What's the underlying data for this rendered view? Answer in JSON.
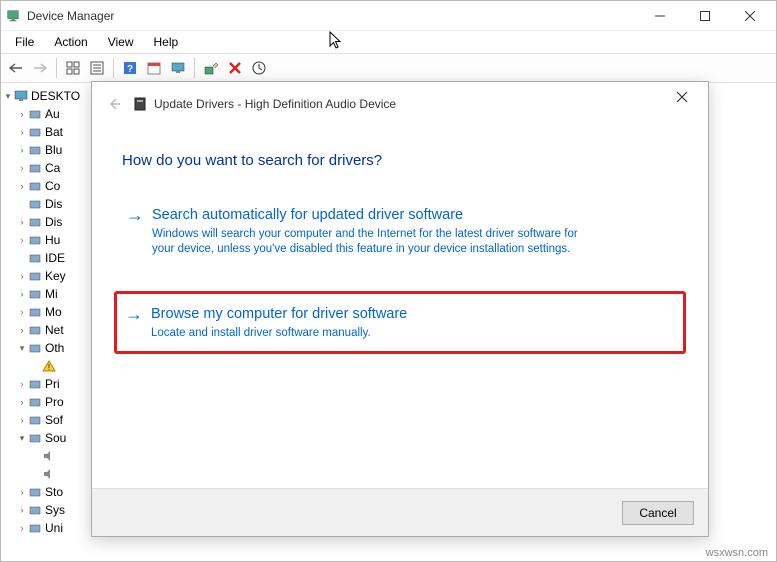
{
  "window": {
    "title": "Device Manager"
  },
  "menu": {
    "file": "File",
    "action": "Action",
    "view": "View",
    "help": "Help"
  },
  "tree": {
    "root": "DESKTO",
    "items": [
      {
        "label": "Au",
        "twist": ">"
      },
      {
        "label": "Bat",
        "twist": ">"
      },
      {
        "label": "Blu",
        "twist": ">"
      },
      {
        "label": "Ca",
        "twist": ">"
      },
      {
        "label": "Co",
        "twist": ">"
      },
      {
        "label": "Dis",
        "twist": " "
      },
      {
        "label": "Dis",
        "twist": ">"
      },
      {
        "label": "Hu",
        "twist": ">"
      },
      {
        "label": "IDE",
        "twist": " "
      },
      {
        "label": "Key",
        "twist": ">"
      },
      {
        "label": "Mi",
        "twist": ">"
      },
      {
        "label": "Mo",
        "twist": ">"
      },
      {
        "label": "Net",
        "twist": ">"
      },
      {
        "label": "Oth",
        "twist": "v"
      },
      {
        "label": "Pri",
        "twist": ">"
      },
      {
        "label": "Pro",
        "twist": ">"
      },
      {
        "label": "Sof",
        "twist": ">"
      },
      {
        "label": "Sou",
        "twist": "v"
      },
      {
        "label": "Sto",
        "twist": ">"
      },
      {
        "label": "Sys",
        "twist": ">"
      },
      {
        "label": "Uni",
        "twist": ">"
      }
    ],
    "indent_after_other": " ",
    "indent_after_sound_1": " ",
    "indent_after_sound_2": " "
  },
  "dialog": {
    "title": "Update Drivers - High Definition Audio Device",
    "heading": "How do you want to search for drivers?",
    "option1": {
      "title": "Search automatically for updated driver software",
      "desc": "Windows will search your computer and the Internet for the latest driver software for your device, unless you've disabled this feature in your device installation settings."
    },
    "option2": {
      "title": "Browse my computer for driver software",
      "desc": "Locate and install driver software manually."
    },
    "cancel": "Cancel"
  },
  "footer": "wsxwsn.com"
}
